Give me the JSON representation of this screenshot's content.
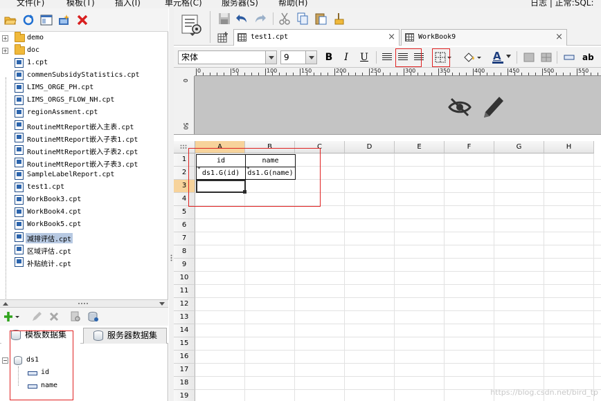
{
  "menubar": {
    "items": [
      "文件(F)",
      "模板(T)",
      "插入(I)",
      "单元格(C)",
      "服务器(S)",
      "帮助(H)"
    ],
    "right_text": "日志 | 正常:SQL:"
  },
  "file_tree": {
    "folders": [
      "demo",
      "doc"
    ],
    "files": [
      "1.cpt",
      "commenSubsidyStatistics.cpt",
      "LIMS_ORGE_PH.cpt",
      "LIMS_ORGS_FLOW_NH.cpt",
      "regionAssment.cpt",
      "RoutineMtReport嵌入主表.cpt",
      "RoutineMtReport嵌入子表1.cpt",
      "RoutineMtReport嵌入子表2.cpt",
      "RoutineMtReport嵌入子表3.cpt",
      "SampleLabelReport.cpt",
      "test1.cpt",
      "WorkBook3.cpt",
      "WorkBook4.cpt",
      "WorkBook5.cpt",
      "减排评估.cpt",
      "区域评估.cpt",
      "补贴统计.cpt"
    ],
    "selected_file": "减排评估.cpt"
  },
  "dataset_panel": {
    "tabs": [
      "模板数据集",
      "服务器数据集"
    ],
    "dataset_name": "ds1",
    "fields": [
      "id",
      "name"
    ]
  },
  "doc_tabs": [
    {
      "label": "test1.cpt",
      "close": "×"
    },
    {
      "label": "WorkBook9",
      "close": "×"
    }
  ],
  "format_toolbar": {
    "font": "宋体",
    "size": "9",
    "bold": "B",
    "italic": "I",
    "underline": "U",
    "text_color_glyph": "A",
    "ab_label": "ab"
  },
  "ruler": {
    "marks": [
      "0",
      "50",
      "100",
      "150",
      "200",
      "250",
      "300",
      "350",
      "400",
      "450",
      "500",
      "550"
    ],
    "left_marks": [
      "0",
      "50"
    ]
  },
  "sheet": {
    "columns": [
      "A",
      "B",
      "C",
      "D",
      "E",
      "F",
      "G",
      "H"
    ],
    "rows": [
      "1",
      "2",
      "3",
      "4",
      "5",
      "6",
      "7",
      "8",
      "9",
      "10",
      "11",
      "12",
      "13",
      "14",
      "15",
      "16",
      "17",
      "18",
      "19"
    ],
    "cells": {
      "A1": "id",
      "B1": "name",
      "A2": "ds1.G(id)",
      "B2": "ds1.G(name)"
    }
  },
  "watermark": "https://blog.csdn.net/bird_tp"
}
